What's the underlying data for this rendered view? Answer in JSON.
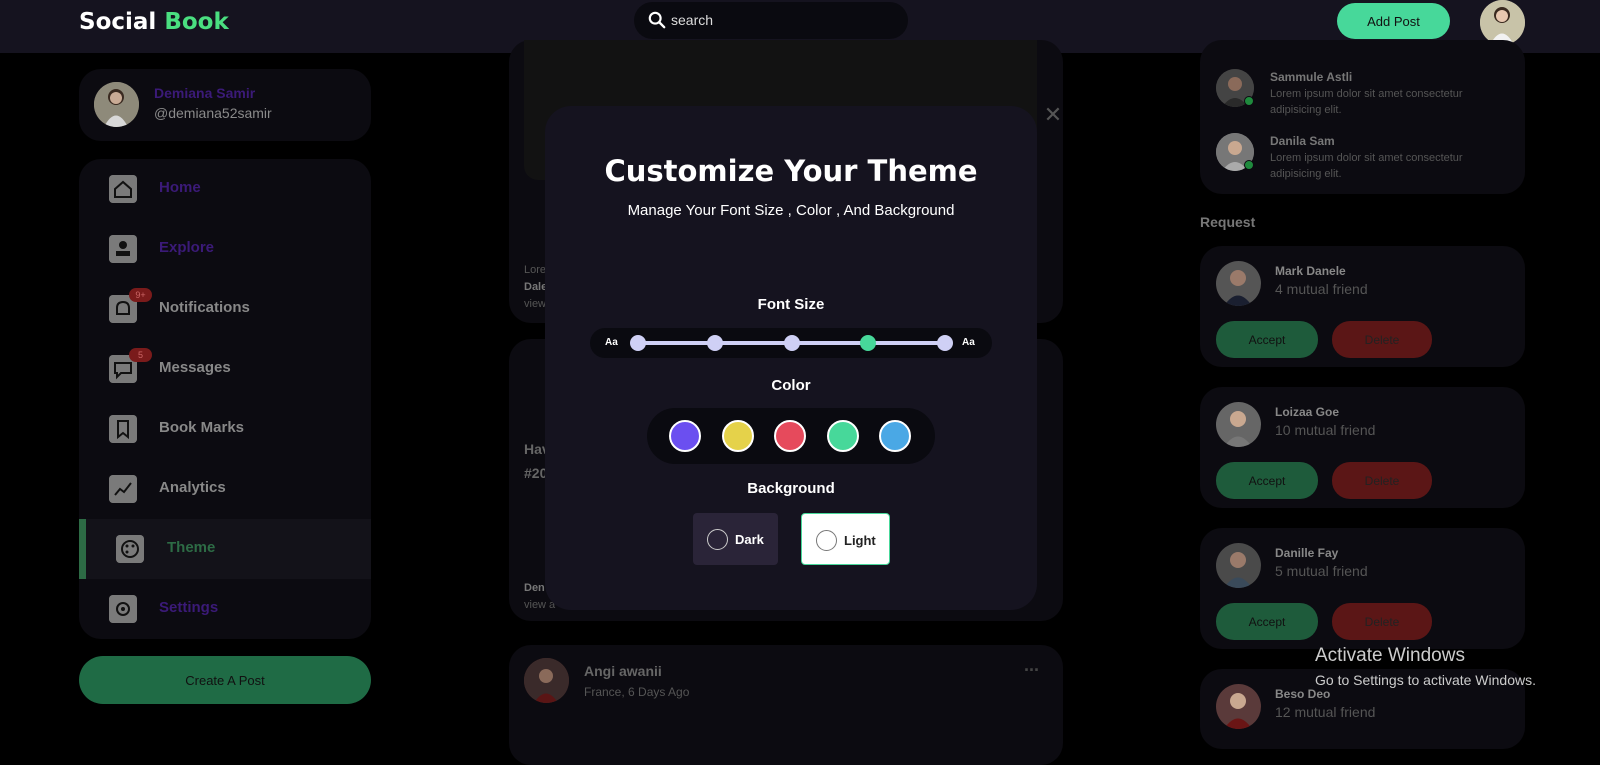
{
  "navbar": {
    "logo_main": "Social",
    "logo_accent": "Book",
    "search_placeholder": "search",
    "add_post_label": "Add Post"
  },
  "profile": {
    "name": "Demiana Samir",
    "handle": "@demiana52samir"
  },
  "menu": [
    {
      "label": "Home"
    },
    {
      "label": "Explore"
    },
    {
      "label": "Notifications",
      "badge": "9+"
    },
    {
      "label": "Messages",
      "badge": "5"
    },
    {
      "label": "Book Marks"
    },
    {
      "label": "Analytics"
    },
    {
      "label": "Theme"
    },
    {
      "label": "Settings"
    }
  ],
  "create_post_label": "Create A Post",
  "feed": {
    "post_a_snippet_1": "Lore",
    "post_a_snippet_2": "Dale",
    "post_a_snippet_3": "view",
    "post_b_snippet_1": "Hav",
    "post_b_snippet_2": "#20",
    "post_b_snippet_3": "Den",
    "post_b_snippet_4": "view a",
    "post_c_author": "Angi awanii",
    "post_c_meta": "France, 6 Days Ago",
    "post_c_more": "..."
  },
  "messages": [
    {
      "name": "Sammule Astli",
      "text": "Lorem ipsum dolor sit amet consectetur adipisicing elit."
    },
    {
      "name": "Danila Sam",
      "text": "Lorem ipsum dolor sit amet consectetur adipisicing elit."
    }
  ],
  "requests": {
    "title": "Request",
    "accept_label": "Accept",
    "delete_label": "Delete",
    "items": [
      {
        "name": "Mark Danele",
        "mutual": "4 mutual friend"
      },
      {
        "name": "Loizaa Goe",
        "mutual": "10 mutual friend"
      },
      {
        "name": "Danille Fay",
        "mutual": "5 mutual friend"
      },
      {
        "name": "Beso Deo",
        "mutual": "12 mutual friend"
      }
    ]
  },
  "watermark": {
    "title": "Activate Windows",
    "subtitle": "Go to Settings to activate Windows."
  },
  "modal": {
    "title": "Customize Your Theme",
    "subtitle": "Manage Your Font Size , Color , And Background",
    "font_size_label": "Font Size",
    "aa_small": "Aa",
    "aa_large": "Aa",
    "font_size_levels": 5,
    "font_size_selected_index": 3,
    "color_label": "Color",
    "colors": [
      "#6b4ff0",
      "#e5d24a",
      "#e64a5c",
      "#47d89a",
      "#4aa8e5"
    ],
    "background_label": "Background",
    "bg_dark_label": "Dark",
    "bg_light_label": "Light",
    "close_glyph": "✕"
  },
  "colors": {
    "accent": "#47d89a",
    "brand_green": "#4ade80",
    "panel": "#15131f"
  }
}
